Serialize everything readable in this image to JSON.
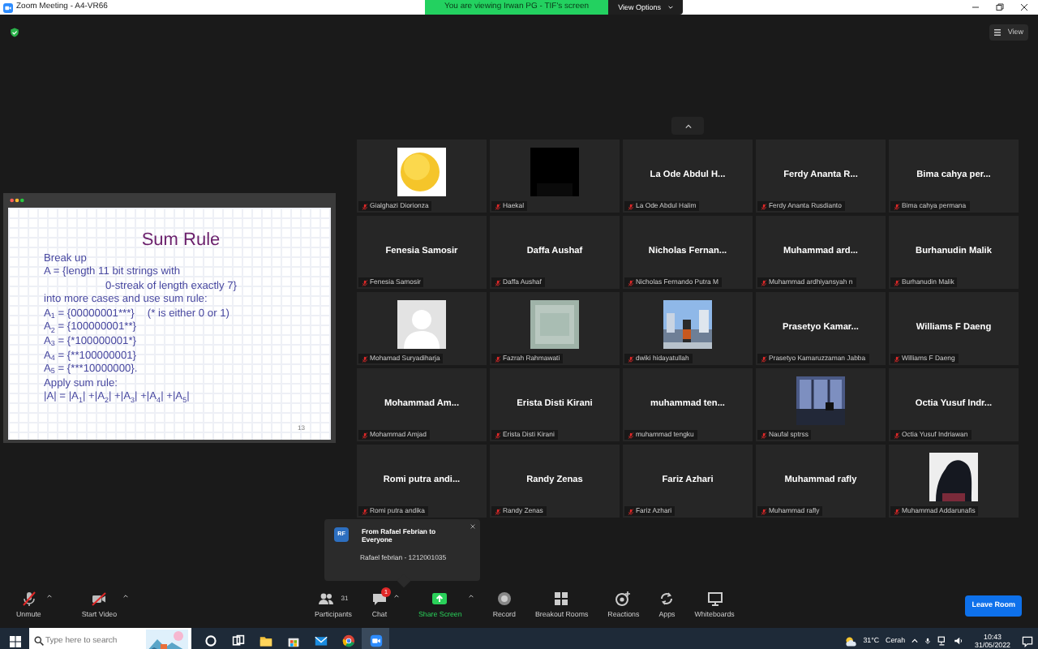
{
  "window": {
    "title": "Zoom Meeting - A4-VR66",
    "banner": "You are viewing Irwan PG - TIF's screen",
    "view_options": "View Options"
  },
  "view_button": "View",
  "shared_slide": {
    "title": "Sum Rule",
    "page": "13",
    "lines": [
      {
        "text": "Break up",
        "indented": false
      },
      {
        "label": "A",
        "text": " = {length 11 bit strings with",
        "indented": false
      },
      {
        "text": "0-streak of length exactly 7}",
        "indented": true
      },
      {
        "text": "into more cases and use sum rule:",
        "indented": false
      },
      {
        "label": "A$_{1}$",
        "text": " = {00000001***}",
        "note": "(* is either 0 or 1)",
        "indented": false
      },
      {
        "label": "A$_{2}$",
        "text": " = {100000001**}",
        "indented": false
      },
      {
        "label": "A$_{3}$",
        "text": " = {*100000001*}",
        "indented": false
      },
      {
        "label": "A$_{4}$",
        "text": " = {**100000001}",
        "indented": false
      },
      {
        "label": "A$_{5}$",
        "text": " = {***10000000}.",
        "indented": false
      },
      {
        "text": "Apply sum rule:",
        "indented": false
      },
      {
        "label": "|A| = |A$_{1}$| +|A$_{2}$| +|A$_{3}$| +|A$_{4}$| +|A$_{5}$|",
        "indented": false
      }
    ]
  },
  "participants": [
    {
      "kind": "picture",
      "label": "Gialghazi Diorionza",
      "muted": true
    },
    {
      "kind": "picture",
      "label": "Haekal",
      "muted": true
    },
    {
      "kind": "name",
      "display_name": "La Ode Abdul H...",
      "label": "La Ode Abdul Halim",
      "muted": true
    },
    {
      "kind": "name",
      "display_name": "Ferdy Ananta R...",
      "label": "Ferdy Ananta Rusdianto",
      "muted": true
    },
    {
      "kind": "name",
      "display_name": "Bima cahya per...",
      "label": "Bima cahya permana",
      "muted": true
    },
    {
      "kind": "name",
      "display_name": "Fenesia Samosir",
      "label": "Fenesia Samosir",
      "muted": true
    },
    {
      "kind": "name",
      "display_name": "Daffa Aushaf",
      "label": "Daffa Aushaf",
      "muted": true
    },
    {
      "kind": "name",
      "display_name": "Nicholas Fernan...",
      "label": "Nicholas Fernando Putra M",
      "muted": true
    },
    {
      "kind": "name",
      "display_name": "Muhammad ard...",
      "label": "Muhammad ardhiyansyah n",
      "muted": true
    },
    {
      "kind": "name",
      "display_name": "Burhanudin Malik",
      "label": "Burhanudin Malik",
      "muted": true
    },
    {
      "kind": "picture",
      "label": "Mohamad Suryadiharja",
      "muted": true
    },
    {
      "kind": "picture",
      "label": "Fazrah Rahmawati",
      "muted": true
    },
    {
      "kind": "picture",
      "label": "dwiki hidayatullah",
      "muted": true
    },
    {
      "kind": "name",
      "display_name": "Prasetyo Kamar...",
      "label": "Prasetyo Kamaruzzaman Jabba",
      "muted": true
    },
    {
      "kind": "name",
      "display_name": "Williams F Daeng",
      "label": "Williams F Daeng",
      "muted": true
    },
    {
      "kind": "name",
      "display_name": "Mohammad Am...",
      "label": "Mohammad Amjad",
      "muted": true
    },
    {
      "kind": "name",
      "display_name": "Erista Disti Kirani",
      "label": "Erista Disti Kirani",
      "muted": true
    },
    {
      "kind": "name",
      "display_name": "muhammad ten...",
      "label": "muhammad tengku",
      "muted": true
    },
    {
      "kind": "picture",
      "label": "Naufal sptrss",
      "muted": true
    },
    {
      "kind": "name",
      "display_name": "Octia Yusuf Indr...",
      "label": "Octia Yusuf Indriawan",
      "muted": true
    },
    {
      "kind": "name",
      "display_name": "Romi putra andi...",
      "label": "Romi putra andika",
      "muted": true
    },
    {
      "kind": "name",
      "display_name": "Randy Zenas",
      "label": "Randy Zenas",
      "muted": true
    },
    {
      "kind": "name",
      "display_name": "Fariz Azhari",
      "label": "Fariz Azhari",
      "muted": true
    },
    {
      "kind": "name",
      "display_name": "Muhammad rafly",
      "label": "Muhammad rafly",
      "muted": true
    },
    {
      "kind": "picture",
      "label": "Muhammad Addarunafis",
      "muted": true
    }
  ],
  "chat_notification": {
    "initials": "RF",
    "title": "From Rafael Febrian to Everyone",
    "message": "Rafael febrian - 1212001035"
  },
  "toolbar": {
    "left": [
      {
        "kind": "mic",
        "label": "Unmute",
        "caret": true
      },
      {
        "kind": "video",
        "label": "Start Video",
        "caret": true
      }
    ],
    "center": [
      {
        "kind": "participants",
        "label": "Participants",
        "count": "31",
        "caret": false
      },
      {
        "kind": "chat",
        "label": "Chat",
        "badge": "1",
        "caret": true
      },
      {
        "kind": "share",
        "label": "Share Screen",
        "caret": true
      },
      {
        "kind": "record",
        "label": "Record",
        "caret": false
      },
      {
        "kind": "breakout",
        "label": "Breakout Rooms",
        "caret": false
      },
      {
        "kind": "reactions",
        "label": "Reactions",
        "caret": false
      },
      {
        "kind": "apps",
        "label": "Apps",
        "caret": false
      },
      {
        "kind": "whiteboard",
        "label": "Whiteboards",
        "caret": false
      }
    ],
    "leave": "Leave Room"
  },
  "taskbar": {
    "search_placeholder": "Type here to search",
    "apps": [
      {
        "kind": "cortana",
        "selected": false
      },
      {
        "kind": "taskview",
        "selected": false
      },
      {
        "kind": "folder",
        "selected": false
      },
      {
        "kind": "store",
        "selected": false
      },
      {
        "kind": "mail",
        "selected": false
      },
      {
        "kind": "browser",
        "selected": false
      },
      {
        "kind": "zoom",
        "selected": true
      }
    ],
    "temperature": "31°C",
    "weather": "Cerah",
    "time": "10:43",
    "date": "31/05/2022"
  }
}
